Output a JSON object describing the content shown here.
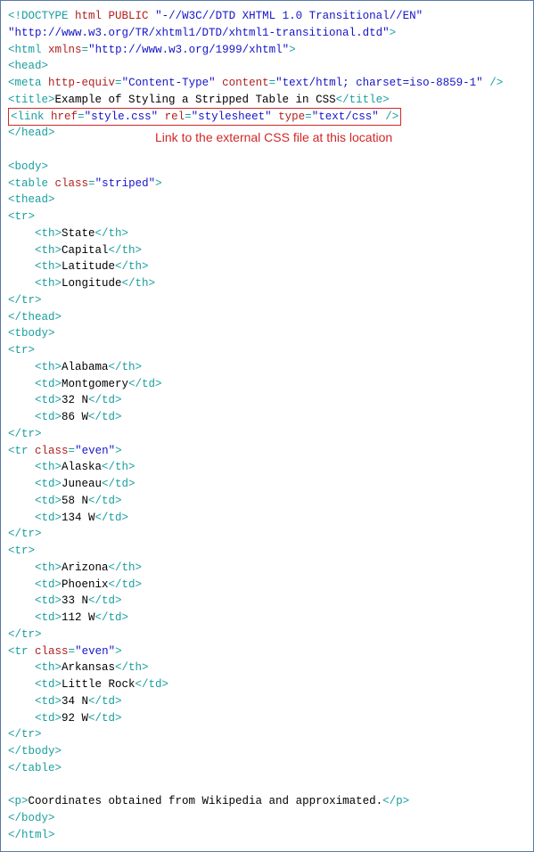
{
  "doctype_open": "<!DOCTYPE",
  "doctype_kw": "html PUBLIC",
  "doctype_fpi": "\"-//W3C//DTD XHTML 1.0 Transitional//EN\"",
  "doctype_uri": "\"http://www.w3.org/TR/xhtml1/DTD/xhtml1-transitional.dtd\"",
  "html_open": "<html",
  "xmlns_name": "xmlns",
  "xmlns_val": "\"http://www.w3.org/1999/xhtml\"",
  "head_open": "<head>",
  "meta_open": "<meta",
  "meta_a1n": "http-equiv",
  "meta_a1v": "\"Content-Type\"",
  "meta_a2n": "content",
  "meta_a2v": "\"text/html; charset=iso-8859-1\"",
  "title_open": "<title>",
  "title_text": "Example of Styling a Stripped Table in CSS",
  "title_close": "</title>",
  "link_open": "<link",
  "link_a1n": "href",
  "link_a1v": "\"style.css\"",
  "link_a2n": "rel",
  "link_a2v": "\"stylesheet\"",
  "link_a3n": "type",
  "link_a3v": "\"text/css\"",
  "head_close": "</head>",
  "annotation": "Link to the external CSS file at this location",
  "body_open": "<body>",
  "table_open": "<table",
  "table_a1n": "class",
  "table_a1v": "\"striped\"",
  "thead_open": "<thead>",
  "tr_open": "<tr>",
  "tr_even_open": "<tr",
  "tr_a1n": "class",
  "tr_a1v": "\"even\"",
  "th_open": "<th>",
  "th_close": "</th>",
  "td_open": "<td>",
  "td_close": "</td>",
  "tr_close": "</tr>",
  "thead_close": "</thead>",
  "tbody_open": "<tbody>",
  "tbody_close": "</tbody>",
  "table_close": "</table>",
  "h": {
    "c1": "State",
    "c2": "Capital",
    "c3": "Latitude",
    "c4": "Longitude"
  },
  "r1": {
    "c1": "Alabama",
    "c2": "Montgomery",
    "c3": "32 N",
    "c4": "86 W"
  },
  "r2": {
    "c1": "Alaska",
    "c2": "Juneau",
    "c3": "58 N",
    "c4": "134 W"
  },
  "r3": {
    "c1": "Arizona",
    "c2": "Phoenix",
    "c3": "33 N",
    "c4": "112 W"
  },
  "r4": {
    "c1": "Arkansas",
    "c2": "Little Rock",
    "c3": "34 N",
    "c4": "92 W"
  },
  "p_open": "<p>",
  "p_text": "Coordinates obtained from Wikipedia and approximated.",
  "p_close": "</p>",
  "body_close": "</body>",
  "html_close": "</html>",
  "gt": ">",
  "sgt": " />",
  "eq": "="
}
